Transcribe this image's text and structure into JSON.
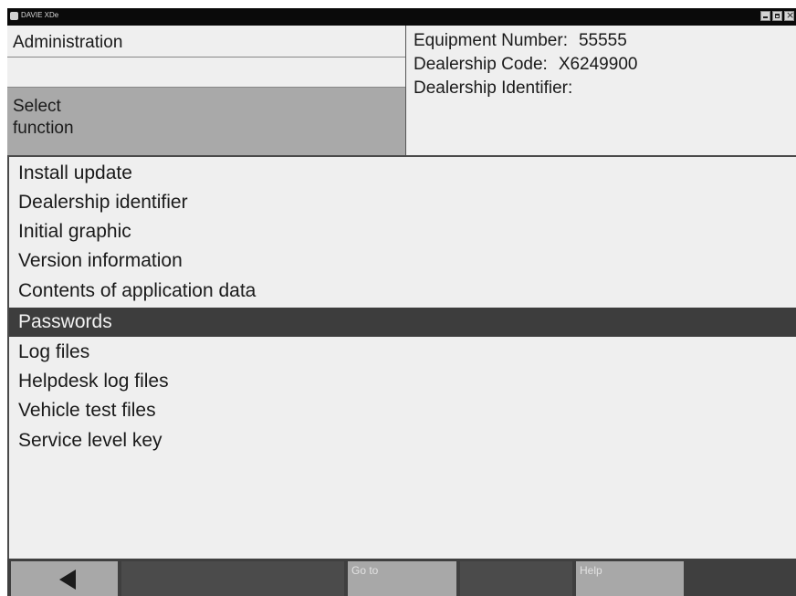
{
  "window": {
    "title": "DAVIE XDe"
  },
  "header": {
    "section": "Administration",
    "prompt_line1": "Select",
    "prompt_line2": "function",
    "equipment_number_label": "Equipment Number:",
    "equipment_number_value": "55555",
    "dealership_code_label": "Dealership Code:",
    "dealership_code_value": "X6249900",
    "dealership_identifier_label": "Dealership Identifier:"
  },
  "menu": {
    "selected_index": 5,
    "items": [
      "Install update",
      "Dealership identifier",
      "Initial graphic",
      "Version information",
      "Contents of application data",
      "Passwords",
      "Log files",
      "Helpdesk log files",
      "Vehicle test files",
      "Service level key"
    ]
  },
  "footer": {
    "back_icon": "left-arrow-icon",
    "goto_label": "Go to",
    "help_label": "Help"
  },
  "colors": {
    "titlebar": "#0a0a0a",
    "selected_row": "#3d3d3d",
    "prompt_bg": "#a9a9a9",
    "footer_bg": "#3f3f3f",
    "footer_button": "#a8a8a8"
  }
}
